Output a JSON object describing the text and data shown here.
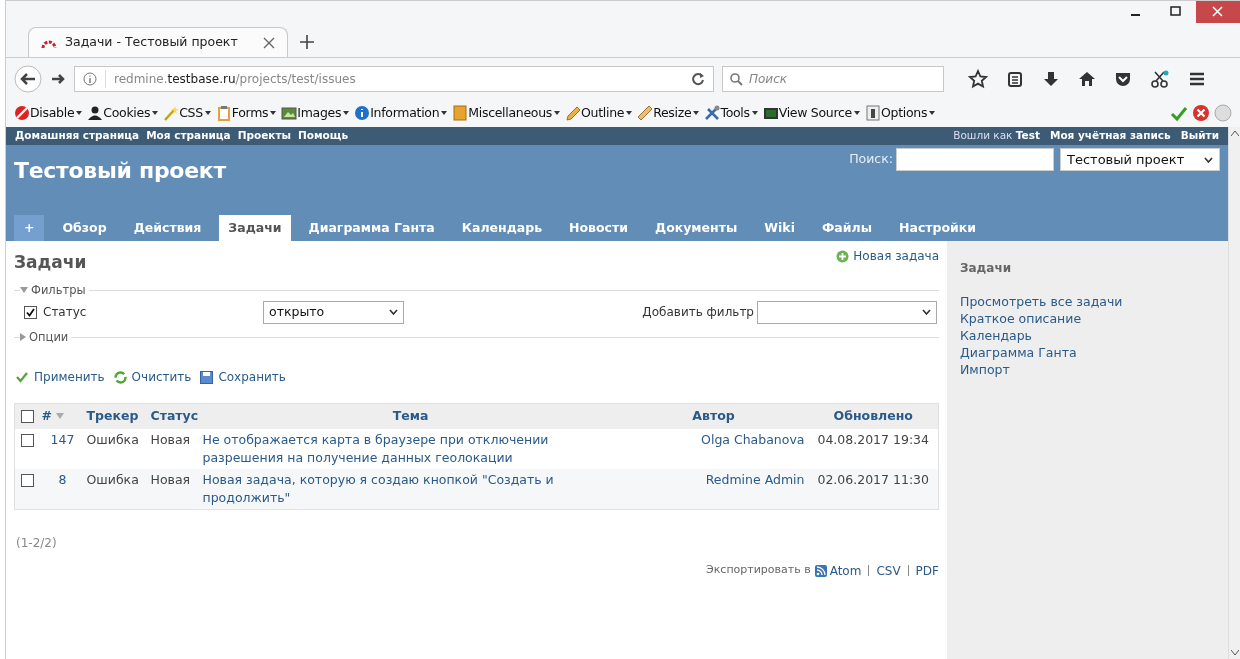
{
  "browser": {
    "tab_title": "Задачи - Тестовый проект",
    "url": "redmine.**testbase.ru**/projects/test/issues",
    "search_placeholder": "Поиск"
  },
  "dev_toolbar": [
    {
      "label": "Disable"
    },
    {
      "label": "Cookies"
    },
    {
      "label": "CSS"
    },
    {
      "label": "Forms"
    },
    {
      "label": "Images"
    },
    {
      "label": "Information"
    },
    {
      "label": "Miscellaneous"
    },
    {
      "label": "Outline"
    },
    {
      "label": "Resize"
    },
    {
      "label": "Tools"
    },
    {
      "label": "View Source"
    },
    {
      "label": "Options"
    }
  ],
  "top_menu": {
    "left": [
      "Домашняя страница",
      "Моя страница",
      "Проекты",
      "Помощь"
    ],
    "logged_in": "Вошли как **Test**",
    "right": [
      "Моя учётная запись",
      "Выйти"
    ]
  },
  "header": {
    "title": "Тестовый проект",
    "search_label": "Поиск:",
    "project_select": "Тестовый проект"
  },
  "tabs": [
    {
      "label": "+",
      "selected": false
    },
    {
      "label": "Обзор",
      "selected": false
    },
    {
      "label": "Действия",
      "selected": false
    },
    {
      "label": "Задачи",
      "selected": true
    },
    {
      "label": "Диаграмма Ганта",
      "selected": false
    },
    {
      "label": "Календарь",
      "selected": false
    },
    {
      "label": "Новости",
      "selected": false
    },
    {
      "label": "Документы",
      "selected": false
    },
    {
      "label": "Wiki",
      "selected": false
    },
    {
      "label": "Файлы",
      "selected": false
    },
    {
      "label": "Настройки",
      "selected": false
    }
  ],
  "main": {
    "heading": "Задачи",
    "new_issue": "Новая задача",
    "filters": {
      "legend": "Фильтры",
      "expanded": true,
      "filter": {
        "label": "Статус",
        "checked": true,
        "operator": "открыто"
      },
      "add_filter_label": "Добавить фильтр"
    },
    "options": {
      "legend": "Опции",
      "expanded": false
    },
    "actions": [
      "Применить",
      "Очистить",
      "Сохранить"
    ],
    "table": {
      "select_all_checked": false,
      "columns": [
        "#",
        "Трекер",
        "Статус",
        "Тема",
        "Автор",
        "Обновлено"
      ],
      "rows": [
        {
          "checked": false,
          "cells": [
            "147",
            "Ошибка",
            "Новая",
            "Не отображается карта в браузере при отключении разрешения на получение данных геолокации",
            "Olga Chabanova",
            "04.08.2017 19:34"
          ]
        },
        {
          "checked": false,
          "cells": [
            "8",
            "Ошибка",
            "Новая",
            "Новая задача, которую я создаю кнопкой \"Создать и продолжить\"",
            "Redmine Admin",
            "02.06.2017 11:30"
          ]
        }
      ]
    },
    "pagination": "(1-2/2)",
    "export_label": "Экспортировать в",
    "export_formats": [
      "Atom",
      "CSV",
      "PDF"
    ]
  },
  "sidebar": {
    "title": "Задачи",
    "links": [
      "Просмотреть все задачи",
      "Краткое описание",
      "Календарь",
      "Диаграмма Ганта",
      "Импорт"
    ]
  }
}
